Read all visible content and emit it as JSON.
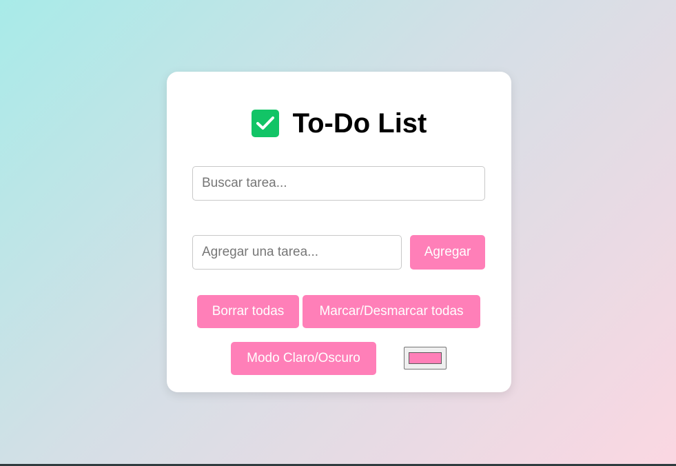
{
  "app": {
    "title": "To-Do List",
    "title_icon": "check-square-icon",
    "icon_color": "#12c466"
  },
  "search": {
    "value": "",
    "placeholder": "Buscar tarea..."
  },
  "task_input": {
    "value": "",
    "placeholder": "Agregar una tarea..."
  },
  "buttons": {
    "add_label": "Agregar",
    "clear_all_label": "Borrar todas",
    "toggle_all_label": "Marcar/Desmarcar todas",
    "mode_label": "Modo Claro/Oscuro"
  },
  "color_picker": {
    "value": "#ff7fb8"
  },
  "colors": {
    "accent": "#ff7fb8",
    "card_background": "#ffffff",
    "gradient_start": "#a8ebe8",
    "gradient_end": "#fbd7e2"
  }
}
